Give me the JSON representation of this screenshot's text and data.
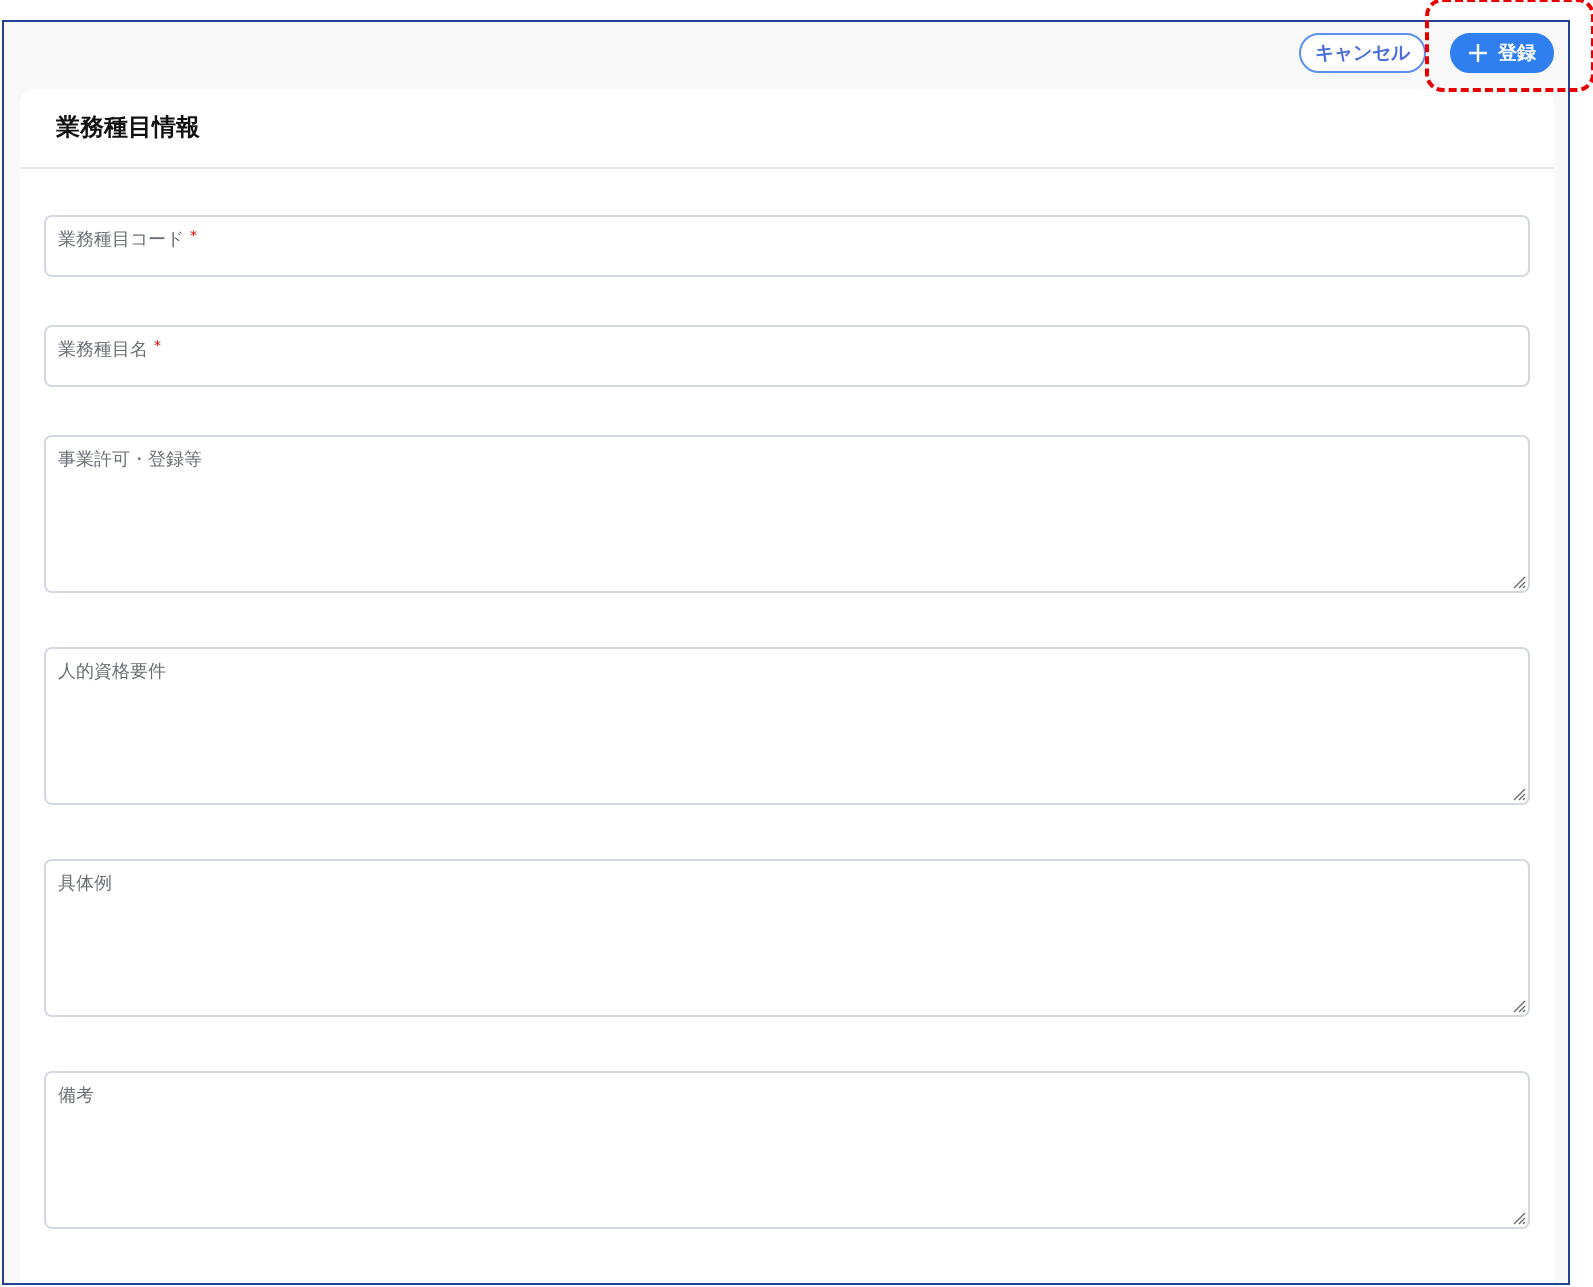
{
  "toolbar": {
    "buttons": [
      {
        "kind": "outline",
        "label": "キャンセル"
      },
      {
        "kind": "primary",
        "label": "登録"
      }
    ]
  },
  "annotation": {
    "highlighted": true
  },
  "card": {
    "title": "業務種目情報",
    "required_mark": "*",
    "fields": [
      {
        "kind": "input",
        "label": "業務種目コード",
        "required": true
      },
      {
        "kind": "input",
        "label": "業務種目名",
        "required": true
      },
      {
        "kind": "textarea",
        "label": "事業許可・登録等",
        "required": false
      },
      {
        "kind": "textarea",
        "label": "人的資格要件",
        "required": false
      },
      {
        "kind": "textarea",
        "label": "具体例",
        "required": false
      },
      {
        "kind": "textarea",
        "label": "備考",
        "required": false
      }
    ]
  }
}
